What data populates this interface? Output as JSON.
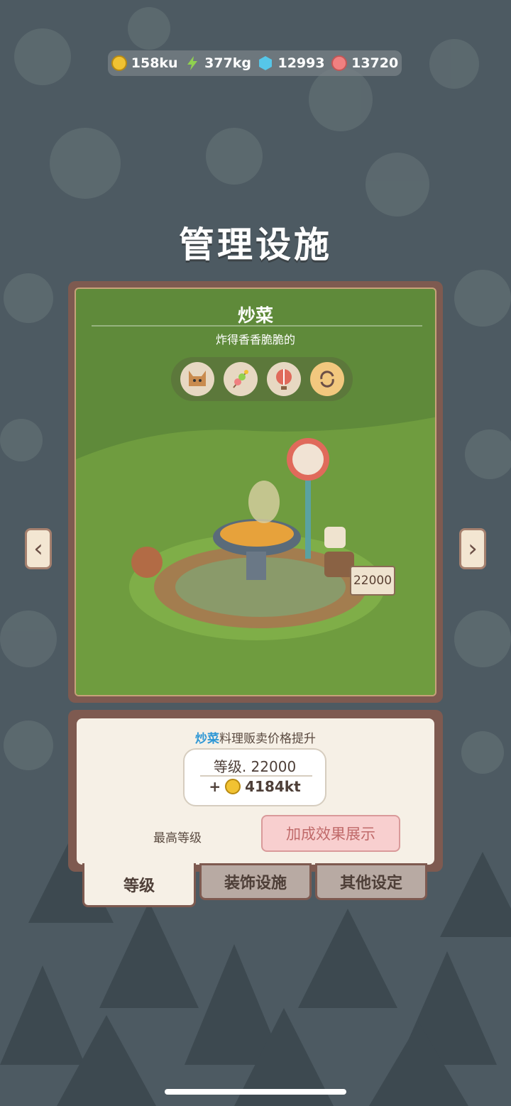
{
  "currencies": [
    {
      "name": "coin-icon",
      "value": "158ku",
      "color": "#f1c232"
    },
    {
      "name": "energy-icon",
      "value": "377kg",
      "color": "#8fd14f"
    },
    {
      "name": "gem-icon",
      "value": "12993",
      "color": "#56c6e8"
    },
    {
      "name": "candy-icon",
      "value": "13720",
      "color": "#f08080"
    }
  ],
  "page_title": "管理设施",
  "facility": {
    "name": "炒菜",
    "description": "炸得香香脆脆的",
    "icons": [
      "cat-icon",
      "skewer-icon",
      "balloon-icon",
      "refresh-icon"
    ],
    "price_sign": "22000"
  },
  "nav": {
    "prev_label": "‹",
    "next_label": "›"
  },
  "bonus": {
    "highlight": "炒菜",
    "text": "料理贩卖价格提升",
    "level_label": "等级. 22000",
    "gain_prefix": "+",
    "gain_value": "4184kt",
    "max_level_label": "最高等级",
    "effect_button": "加成效果展示"
  },
  "tabs": [
    {
      "label": "等级",
      "active": true
    },
    {
      "label": "装饰设施",
      "active": false
    },
    {
      "label": "其他设定",
      "active": false
    }
  ],
  "colors": {
    "panel_border": "#7e5a50",
    "grass": "#5f8a3a",
    "accent_blue": "#2e97d5",
    "button_pink": "#f8cfcf"
  }
}
